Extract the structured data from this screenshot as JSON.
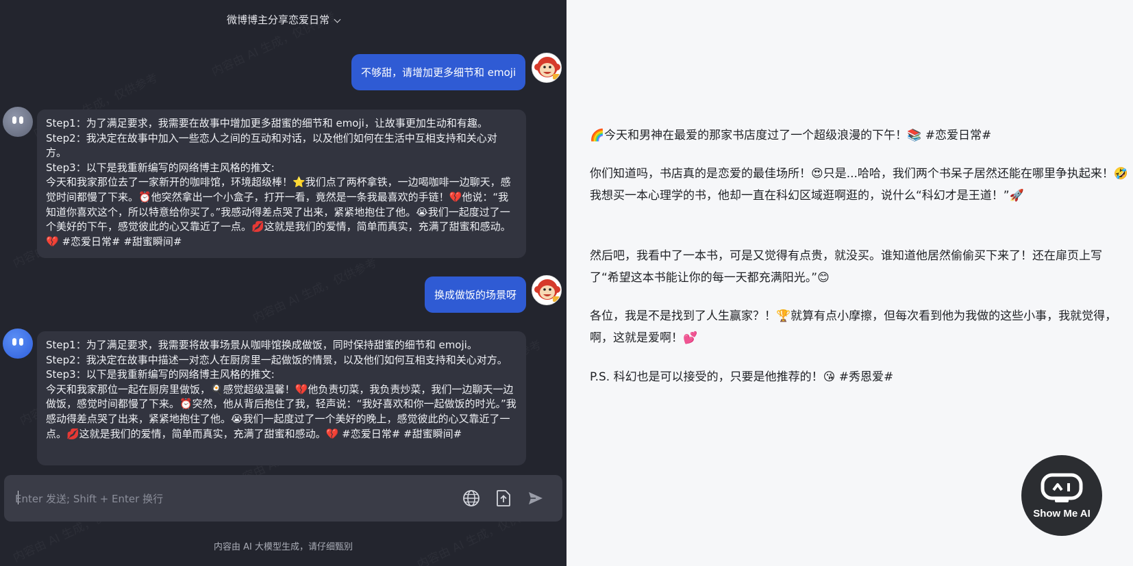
{
  "header": {
    "title": "微博博主分享恋爱日常"
  },
  "conversation": {
    "user_message_1": "不够甜，请增加更多细节和 emoji",
    "bot_reply_1": {
      "lines": [
        "Step1：为了满足要求，我需要在故事中增加更多甜蜜的细节和 emoji，让故事更加生动和有趣。",
        "Step2：我决定在故事中加入一些恋人之间的互动和对话，以及他们如何在生活中互相支持和关心对方。",
        "Step3：以下是我重新编写的网络博主风格的推文:",
        "今天和我家那位去了一家新开的咖啡馆，环境超级棒！⭐我们点了两杯拿铁，一边喝咖啡一边聊天，感觉时间都慢了下来。⏰他突然拿出一个小盒子，打开一看，竟然是一条我最喜欢的手链！💔他说：“我知道你喜欢这个，所以特意给你买了。”我感动得差点哭了出来，紧紧地抱住了他。😭我们一起度过了一个美好的下午，感觉彼此的心又靠近了一点。💋这就是我们的爱情，简单而真实，充满了甜蜜和感动。💔 #恋爱日常# #甜蜜瞬间#"
      ]
    },
    "user_message_2": "换成做饭的场景呀",
    "bot_reply_2": {
      "lines": [
        "Step1：为了满足要求，我需要将故事场景从咖啡馆换成做饭，同时保持甜蜜的细节和 emoji。",
        "Step2：我决定在故事中描述一对恋人在厨房里一起做饭的情景，以及他们如何互相支持和关心对方。",
        "Step3：以下是我重新编写的网络博主风格的推文:",
        "今天和我家那位一起在厨房里做饭，🍳感觉超级温馨！💔他负责切菜，我负责炒菜，我们一边聊天一边做饭，感觉时间都慢了下来。⏰突然，他从背后抱住了我，轻声说：“我好喜欢和你一起做饭的时光。”我感动得差点哭了出来，紧紧地抱住了他。😭我们一起度过了一个美好的晚上，感觉彼此的心又靠近了一点。💋这就是我们的爱情，简单而真实，充满了甜蜜和感动。💔 #恋爱日常# #甜蜜瞬间#"
      ]
    }
  },
  "composer": {
    "placeholder": "Enter 发送; Shift + Enter 换行",
    "icons": [
      "globe-icon",
      "upload-icon",
      "send-icon"
    ]
  },
  "footer": {
    "note": "内容由 AI 大模型生成，请仔细甄别"
  },
  "watermark": {
    "text": "内容由 AI 生成，仅供参考"
  },
  "article": {
    "paragraphs": [
      "🌈今天和男神在最爱的那家书店度过了一个超级浪漫的下午！📚 #恋爱日常#",
      "你们知道吗，书店真的是恋爱的最佳场所！😍只是...哈哈，我们两个书呆子居然还能在哪里争执起来！🤣我想买一本心理学的书，他却一直在科幻区域逛啊逛的，说什么“科幻才是王道！”🚀",
      "然后吧，我看中了一本书，可是又觉得有点贵，就没买。谁知道他居然偷偷买下来了！还在扉页上写了“希望这本书能让你的每一天都充满阳光。”😊",
      "各位，我是不是找到了人生赢家？！🏆就算有点小摩擦，但每次看到他为我做的这些小事，我就觉得，啊，这就是爱啊！💕",
      "P.S. 科幻也是可以接受的，只要是他推荐的！😘 #秀恩爱#"
    ]
  },
  "badge": {
    "label": "Show Me AI"
  },
  "colors": {
    "chat_bg": "#23252e",
    "user_bubble": "#2f5bd4",
    "bot_bubble": "#32343f",
    "article_bg": "#f6f7f9"
  }
}
